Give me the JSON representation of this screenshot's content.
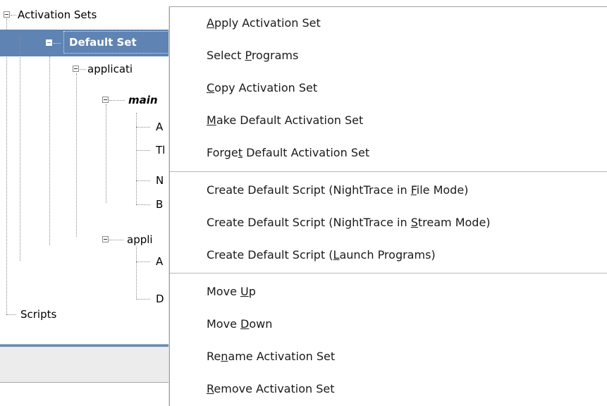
{
  "tree": {
    "root": "Activation Sets",
    "selected_set": "Default Set",
    "app1_label": "applicati",
    "main_label": "main",
    "main_children": [
      "A",
      "Tl",
      "N",
      "B"
    ],
    "app2_label": "appli",
    "app2_children": [
      "A",
      "D"
    ],
    "scripts": "Scripts"
  },
  "menu": {
    "items": [
      {
        "pre": "",
        "key": "A",
        "post": "pply Activation Set"
      },
      {
        "pre": "Select ",
        "key": "P",
        "post": "rograms"
      },
      {
        "pre": "",
        "key": "C",
        "post": "opy Activation Set"
      },
      {
        "pre": "",
        "key": "M",
        "post": "ake Default Activation Set"
      },
      {
        "pre": "Forge",
        "key": "t",
        "post": " Default Activation Set"
      },
      {
        "pre": "Create Default Script (NightTrace in ",
        "key": "F",
        "post": "ile Mode)"
      },
      {
        "pre": "Create Default Script (NightTrace in ",
        "key": "S",
        "post": "tream Mode)"
      },
      {
        "pre": "Create Default Script (",
        "key": "L",
        "post": "aunch Programs)"
      },
      {
        "pre": "Move ",
        "key": "U",
        "post": "p"
      },
      {
        "pre": "Move ",
        "key": "D",
        "post": "own"
      },
      {
        "pre": "Re",
        "key": "n",
        "post": "ame Activation Set"
      },
      {
        "pre": "",
        "key": "R",
        "post": "emove Activation Set"
      }
    ]
  },
  "colors": {
    "selection": "#5f83b3",
    "menu_bg": "#ffffff",
    "separator": "#b9b9b9"
  }
}
